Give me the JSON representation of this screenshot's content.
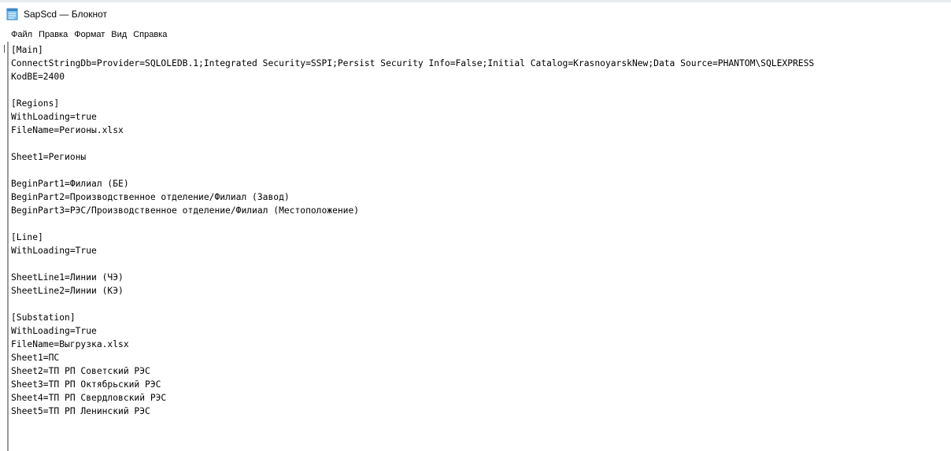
{
  "window": {
    "title": "SapScd — Блокнот"
  },
  "menu": {
    "items": [
      "Файл",
      "Правка",
      "Формат",
      "Вид",
      "Справка"
    ]
  },
  "editor": {
    "lines": [
      "[Main]",
      "ConnectStringDb=Provider=SQLOLEDB.1;Integrated Security=SSPI;Persist Security Info=False;Initial Catalog=KrasnoyarskNew;Data Source=PHANTOM\\SQLEXPRESS",
      "KodBE=2400",
      "",
      "[Regions]",
      "WithLoading=true",
      "FileName=Регионы.xlsx",
      "",
      "Sheet1=Регионы",
      "",
      "BeginPart1=Филиал (БЕ)",
      "BeginPart2=Производственное отделение/Филиал (Завод)",
      "BeginPart3=РЭС/Производственное отделение/Филиал (Местоположение)",
      "",
      "[Line]",
      "WithLoading=True",
      "",
      "SheetLine1=Линии (ЧЭ)",
      "SheetLine2=Линии (КЭ)",
      "",
      "[Substation]",
      "WithLoading=True",
      "FileName=Выгрузка.xlsx",
      "Sheet1=ПС",
      "Sheet2=ТП РП Советский РЭС",
      "Sheet3=ТП РП Октябрьский РЭС",
      "Sheet4=ТП РП Свердловский РЭС",
      "Sheet5=ТП РП Ленинский РЭС"
    ]
  },
  "icons": {
    "app": "notepad-icon"
  }
}
